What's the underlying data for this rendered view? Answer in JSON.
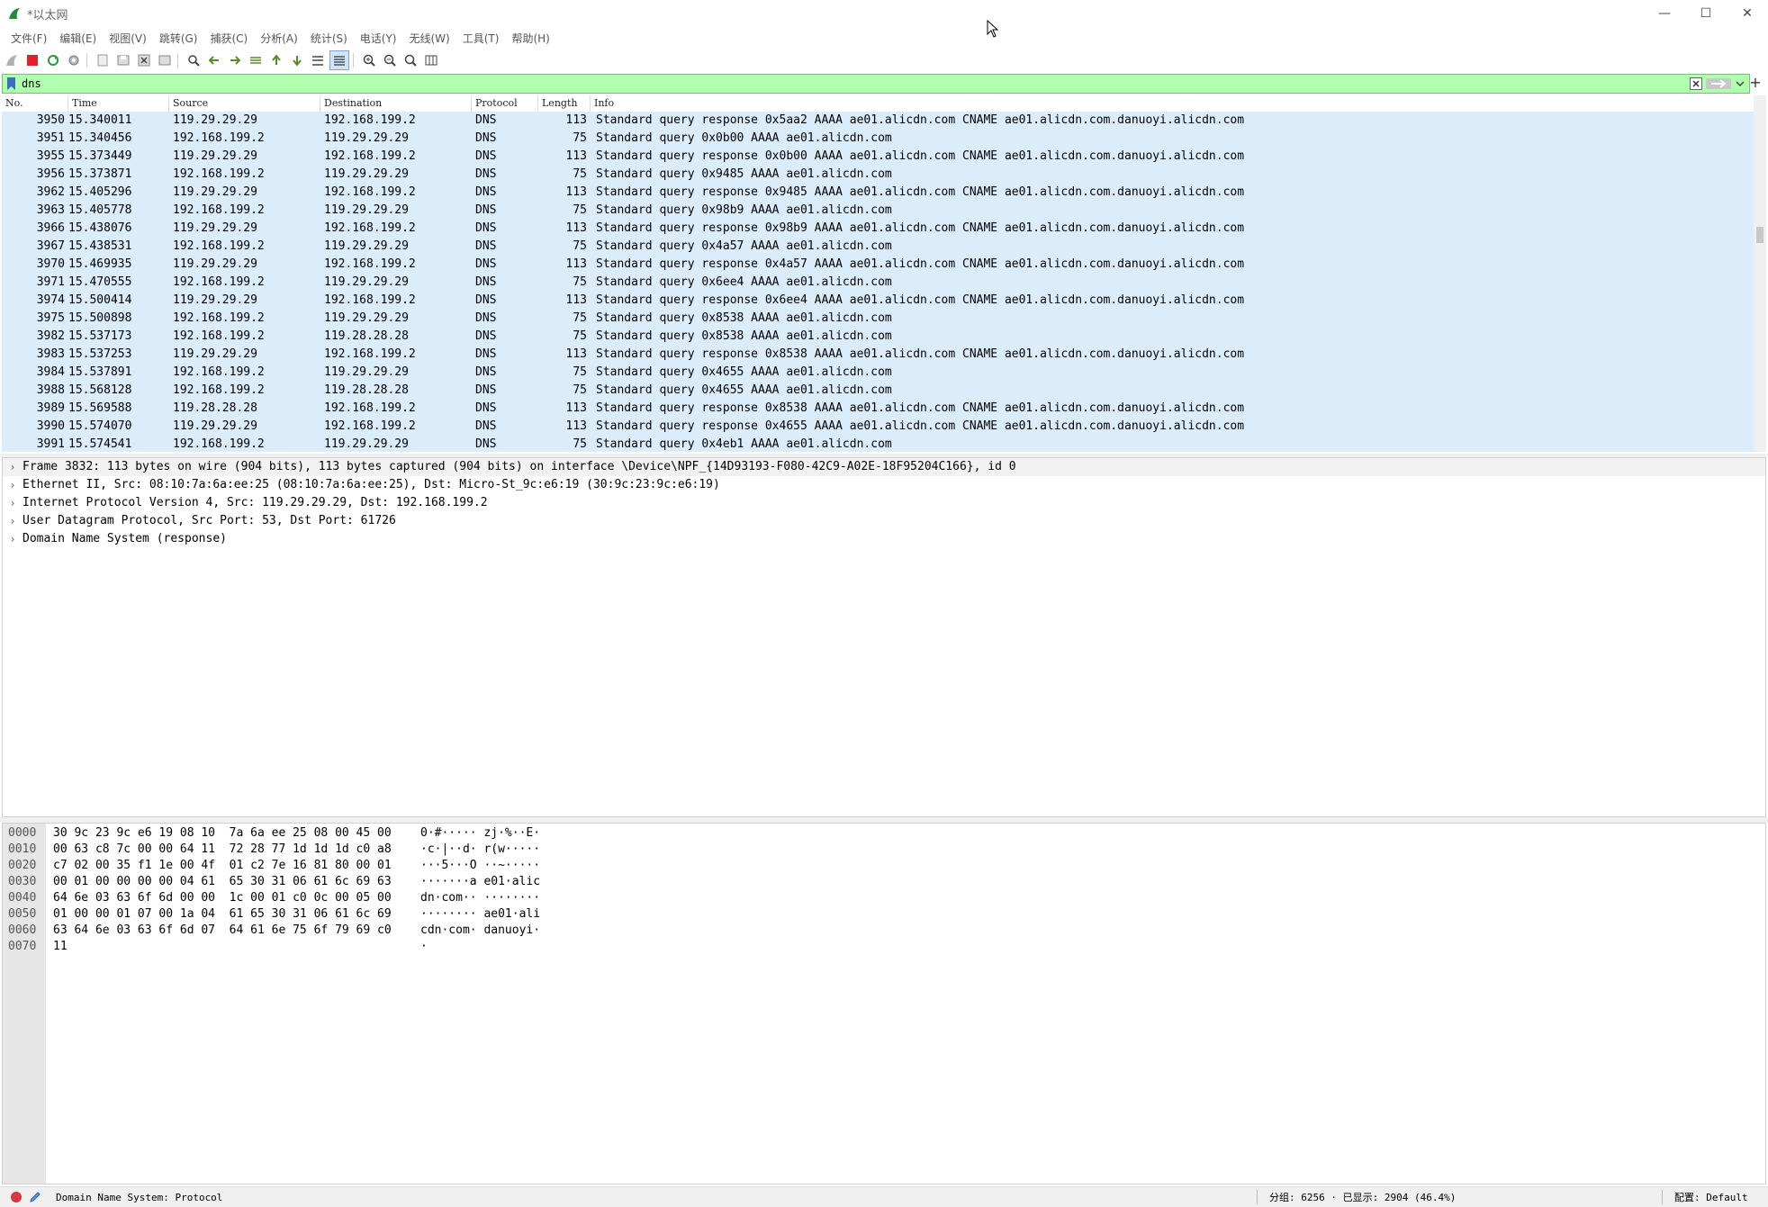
{
  "window": {
    "title": "*以太网"
  },
  "menu": [
    "文件(F)",
    "编辑(E)",
    "视图(V)",
    "跳转(G)",
    "捕获(C)",
    "分析(A)",
    "统计(S)",
    "电话(Y)",
    "无线(W)",
    "工具(T)",
    "帮助(H)"
  ],
  "toolbar_icons": [
    "shark-fin-start-icon",
    "stop-capture-icon",
    "restart-capture-icon",
    "capture-options-icon",
    "open-file-icon",
    "save-file-icon",
    "close-file-icon",
    "reload-file-icon",
    "find-packet-icon",
    "go-back-icon",
    "go-forward-icon",
    "go-to-packet-icon",
    "first-packet-icon",
    "last-packet-icon",
    "auto-scroll-icon",
    "colorize-icon",
    "zoom-in-icon",
    "zoom-out-icon",
    "normal-size-icon",
    "resize-columns-icon"
  ],
  "filter": {
    "value": "dns"
  },
  "columns": [
    "No.",
    "Time",
    "Source",
    "Destination",
    "Protocol",
    "Length",
    "Info"
  ],
  "packets": [
    {
      "no": "3950",
      "time": "15.340011",
      "src": "119.29.29.29",
      "dst": "192.168.199.2",
      "proto": "DNS",
      "len": "113",
      "info": "Standard query response 0x5aa2 AAAA ae01.alicdn.com CNAME ae01.alicdn.com.danuoyi.alicdn.com"
    },
    {
      "no": "3951",
      "time": "15.340456",
      "src": "192.168.199.2",
      "dst": "119.29.29.29",
      "proto": "DNS",
      "len": "75",
      "info": "Standard query 0x0b00 AAAA ae01.alicdn.com"
    },
    {
      "no": "3955",
      "time": "15.373449",
      "src": "119.29.29.29",
      "dst": "192.168.199.2",
      "proto": "DNS",
      "len": "113",
      "info": "Standard query response 0x0b00 AAAA ae01.alicdn.com CNAME ae01.alicdn.com.danuoyi.alicdn.com"
    },
    {
      "no": "3956",
      "time": "15.373871",
      "src": "192.168.199.2",
      "dst": "119.29.29.29",
      "proto": "DNS",
      "len": "75",
      "info": "Standard query 0x9485 AAAA ae01.alicdn.com"
    },
    {
      "no": "3962",
      "time": "15.405296",
      "src": "119.29.29.29",
      "dst": "192.168.199.2",
      "proto": "DNS",
      "len": "113",
      "info": "Standard query response 0x9485 AAAA ae01.alicdn.com CNAME ae01.alicdn.com.danuoyi.alicdn.com"
    },
    {
      "no": "3963",
      "time": "15.405778",
      "src": "192.168.199.2",
      "dst": "119.29.29.29",
      "proto": "DNS",
      "len": "75",
      "info": "Standard query 0x98b9 AAAA ae01.alicdn.com"
    },
    {
      "no": "3966",
      "time": "15.438076",
      "src": "119.29.29.29",
      "dst": "192.168.199.2",
      "proto": "DNS",
      "len": "113",
      "info": "Standard query response 0x98b9 AAAA ae01.alicdn.com CNAME ae01.alicdn.com.danuoyi.alicdn.com"
    },
    {
      "no": "3967",
      "time": "15.438531",
      "src": "192.168.199.2",
      "dst": "119.29.29.29",
      "proto": "DNS",
      "len": "75",
      "info": "Standard query 0x4a57 AAAA ae01.alicdn.com"
    },
    {
      "no": "3970",
      "time": "15.469935",
      "src": "119.29.29.29",
      "dst": "192.168.199.2",
      "proto": "DNS",
      "len": "113",
      "info": "Standard query response 0x4a57 AAAA ae01.alicdn.com CNAME ae01.alicdn.com.danuoyi.alicdn.com"
    },
    {
      "no": "3971",
      "time": "15.470555",
      "src": "192.168.199.2",
      "dst": "119.29.29.29",
      "proto": "DNS",
      "len": "75",
      "info": "Standard query 0x6ee4 AAAA ae01.alicdn.com"
    },
    {
      "no": "3974",
      "time": "15.500414",
      "src": "119.29.29.29",
      "dst": "192.168.199.2",
      "proto": "DNS",
      "len": "113",
      "info": "Standard query response 0x6ee4 AAAA ae01.alicdn.com CNAME ae01.alicdn.com.danuoyi.alicdn.com"
    },
    {
      "no": "3975",
      "time": "15.500898",
      "src": "192.168.199.2",
      "dst": "119.29.29.29",
      "proto": "DNS",
      "len": "75",
      "info": "Standard query 0x8538 AAAA ae01.alicdn.com"
    },
    {
      "no": "3982",
      "time": "15.537173",
      "src": "192.168.199.2",
      "dst": "119.28.28.28",
      "proto": "DNS",
      "len": "75",
      "info": "Standard query 0x8538 AAAA ae01.alicdn.com"
    },
    {
      "no": "3983",
      "time": "15.537253",
      "src": "119.29.29.29",
      "dst": "192.168.199.2",
      "proto": "DNS",
      "len": "113",
      "info": "Standard query response 0x8538 AAAA ae01.alicdn.com CNAME ae01.alicdn.com.danuoyi.alicdn.com"
    },
    {
      "no": "3984",
      "time": "15.537891",
      "src": "192.168.199.2",
      "dst": "119.29.29.29",
      "proto": "DNS",
      "len": "75",
      "info": "Standard query 0x4655 AAAA ae01.alicdn.com"
    },
    {
      "no": "3988",
      "time": "15.568128",
      "src": "192.168.199.2",
      "dst": "119.28.28.28",
      "proto": "DNS",
      "len": "75",
      "info": "Standard query 0x4655 AAAA ae01.alicdn.com"
    },
    {
      "no": "3989",
      "time": "15.569588",
      "src": "119.28.28.28",
      "dst": "192.168.199.2",
      "proto": "DNS",
      "len": "113",
      "info": "Standard query response 0x8538 AAAA ae01.alicdn.com CNAME ae01.alicdn.com.danuoyi.alicdn.com"
    },
    {
      "no": "3990",
      "time": "15.574070",
      "src": "119.29.29.29",
      "dst": "192.168.199.2",
      "proto": "DNS",
      "len": "113",
      "info": "Standard query response 0x4655 AAAA ae01.alicdn.com CNAME ae01.alicdn.com.danuoyi.alicdn.com"
    },
    {
      "no": "3991",
      "time": "15.574541",
      "src": "192.168.199.2",
      "dst": "119.29.29.29",
      "proto": "DNS",
      "len": "75",
      "info": "Standard query 0x4eb1 AAAA ae01.alicdn.com"
    }
  ],
  "details": [
    "Frame 3832: 113 bytes on wire (904 bits), 113 bytes captured (904 bits) on interface \\Device\\NPF_{14D93193-F080-42C9-A02E-18F95204C166}, id 0",
    "Ethernet II, Src: 08:10:7a:6a:ee:25 (08:10:7a:6a:ee:25), Dst: Micro-St_9c:e6:19 (30:9c:23:9c:e6:19)",
    "Internet Protocol Version 4, Src: 119.29.29.29, Dst: 192.168.199.2",
    "User Datagram Protocol, Src Port: 53, Dst Port: 61726",
    "Domain Name System (response)"
  ],
  "hexdump": [
    {
      "offset": "0000",
      "hex": "30 9c 23 9c e6 19 08 10  7a 6a ee 25 08 00 45 00",
      "ascii": "0·#····· zj·%··E·"
    },
    {
      "offset": "0010",
      "hex": "00 63 c8 7c 00 00 64 11  72 28 77 1d 1d 1d c0 a8",
      "ascii": "·c·|··d· r(w·····"
    },
    {
      "offset": "0020",
      "hex": "c7 02 00 35 f1 1e 00 4f  01 c2 7e 16 81 80 00 01",
      "ascii": "···5···O ··~·····"
    },
    {
      "offset": "0030",
      "hex": "00 01 00 00 00 00 04 61  65 30 31 06 61 6c 69 63",
      "ascii": "·······a e01·alic"
    },
    {
      "offset": "0040",
      "hex": "64 6e 03 63 6f 6d 00 00  1c 00 01 c0 0c 00 05 00",
      "ascii": "dn·com·· ········"
    },
    {
      "offset": "0050",
      "hex": "01 00 00 01 07 00 1a 04  61 65 30 31 06 61 6c 69",
      "ascii": "········ ae01·ali"
    },
    {
      "offset": "0060",
      "hex": "63 64 6e 03 63 6f 6d 07  64 61 6e 75 6f 79 69 c0",
      "ascii": "cdn·com· danuoyi·"
    },
    {
      "offset": "0070",
      "hex": "11",
      "ascii": "·"
    }
  ],
  "status": {
    "field": "Domain Name System: Protocol",
    "packets": "分组: 6256 · 已显示: 2904 (46.4%)",
    "profile": "配置: Default"
  },
  "colors": {
    "row_bg": "#dbecfb",
    "filter_bg": "#afffaf"
  }
}
